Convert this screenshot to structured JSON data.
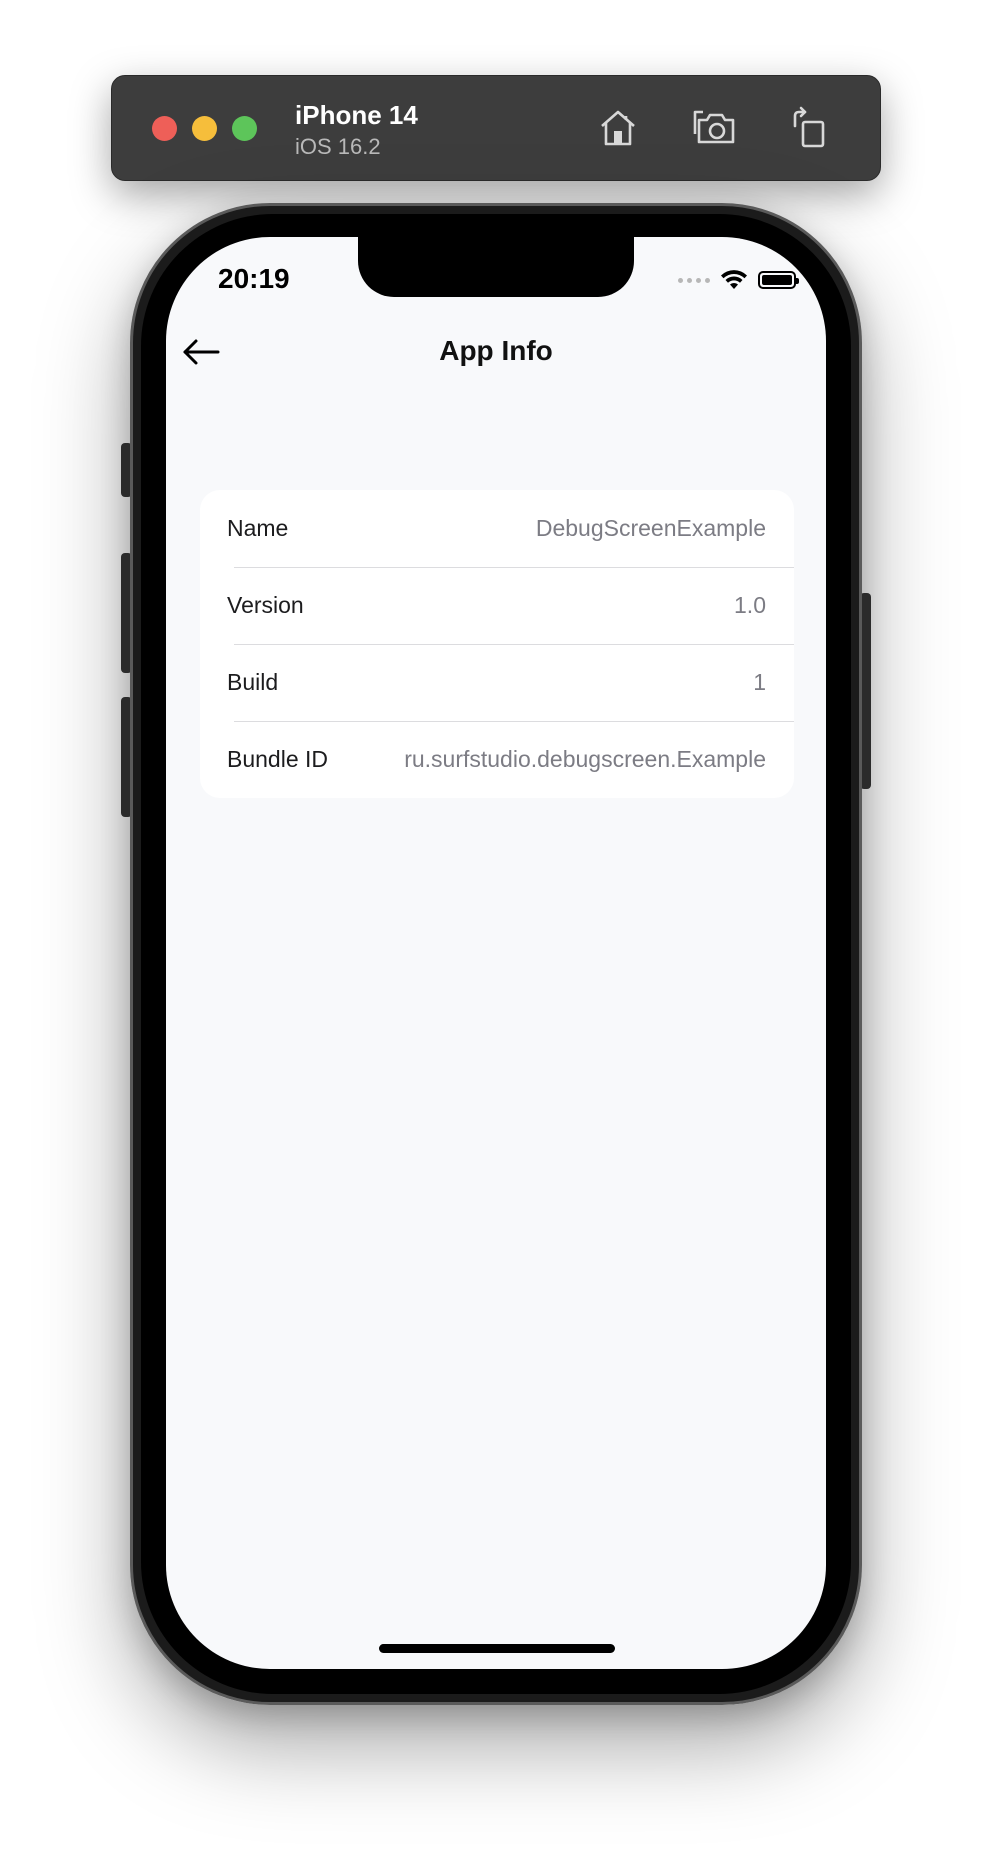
{
  "simulator": {
    "device_name": "iPhone 14",
    "os_version": "iOS 16.2",
    "toolbar_icons": [
      "home-icon",
      "screenshot-icon",
      "rotate-icon"
    ]
  },
  "status_bar": {
    "time": "20:19",
    "icons": [
      "signal-icon",
      "wifi-icon",
      "battery-icon"
    ]
  },
  "nav": {
    "back_icon": "back-arrow-icon",
    "title": "App Info"
  },
  "app_info": {
    "rows": [
      {
        "label": "Name",
        "value": "DebugScreenExample"
      },
      {
        "label": "Version",
        "value": "1.0"
      },
      {
        "label": "Build",
        "value": "1"
      },
      {
        "label": "Bundle ID",
        "value": "ru.surfstudio.debugscreen.Example"
      }
    ]
  },
  "colors": {
    "toolbar_bg": "#3d3d3d",
    "screen_bg": "#f8f9fb",
    "card_bg": "#ffffff",
    "value_text": "#7c7c84",
    "traffic_red": "#ee5f58",
    "traffic_yellow": "#f6be3b",
    "traffic_green": "#5dc55a"
  }
}
